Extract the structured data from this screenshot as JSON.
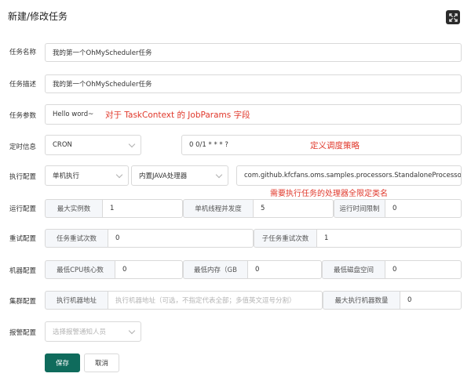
{
  "dialog": {
    "title": "新建/修改任务"
  },
  "labels": {
    "task_name": "任务名称",
    "task_desc": "任务描述",
    "task_params": "任务参数",
    "timing": "定时信息",
    "execution": "执行配置",
    "runtime": "运行配置",
    "retry": "重试配置",
    "machine": "机器配置",
    "cluster": "集群配置",
    "alarm": "报警配置"
  },
  "fields": {
    "task_name": "我的第一个OhMyScheduler任务",
    "task_desc": "我的第一个OhMyScheduler任务",
    "task_params": "Hello word~",
    "time_type": "CRON",
    "time_expr": "0 0/1 * * * ?",
    "execute_type": "单机执行",
    "processor_type": "内置JAVA处理器",
    "processor_info": "com.github.kfcfans.oms.samples.processors.StandaloneProcessorDemo"
  },
  "runtime": {
    "max_instances_label": "最大实例数",
    "max_instances": "1",
    "threads_label": "单机线程并发度",
    "threads": "5",
    "time_limit_label": "运行时间限制",
    "time_limit": "0"
  },
  "retry": {
    "task_retry_label": "任务重试次数",
    "task_retry": "0",
    "subtask_retry_label": "子任务重试次数",
    "subtask_retry": "1"
  },
  "machine": {
    "min_cpu_label": "最低CPU核心数",
    "min_cpu": "0",
    "min_memory_label": "最低内存（GB",
    "min_memory": "0",
    "min_disk_label": "最低磁盘空间",
    "min_disk": "0"
  },
  "cluster": {
    "address_label": "执行机器地址",
    "address_placeholder": "执行机器地址（可选，不指定代表全部；多值英文逗号分割）",
    "max_machines_label": "最大执行机器数量",
    "max_machines": "0"
  },
  "alarm": {
    "placeholder": "选择报警通知人员"
  },
  "annotations": {
    "params_note": "对于 TaskContext 的 JobParams 字段",
    "timing_note": "定义调度策略",
    "processor_note": "需要执行任务的处理器全限定类名"
  },
  "buttons": {
    "save": "保存",
    "cancel": "取消"
  },
  "colors": {
    "primary": "#0f6b5c",
    "annotation": "#e0382b"
  }
}
